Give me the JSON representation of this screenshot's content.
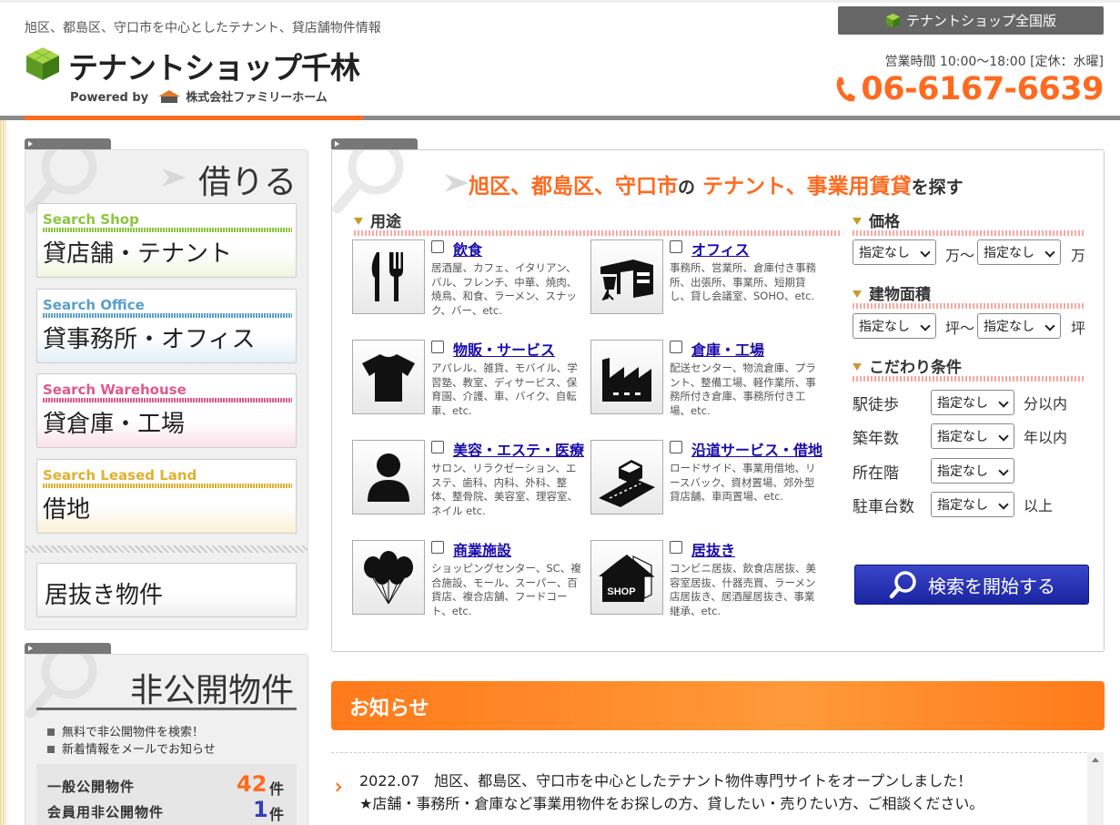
{
  "header": {
    "tagline": "旭区、都島区、守口市を中心としたテナント、貸店舗物件情報",
    "logo_name": "テナントショップ千林",
    "powered_by": "Powered by",
    "company": "株式会社ファミリーホーム",
    "national_button": "テナントショップ全国版",
    "hours": "営業時間 10:00〜18:00 [定休：水曜]",
    "phone": "06-6167-6639"
  },
  "sidebar": {
    "rent_title": "借りる",
    "items": [
      {
        "en": "Search Shop",
        "jp": "貸店舗・テナント",
        "color": "#8cc63f"
      },
      {
        "en": "Search Office",
        "jp": "貸事務所・オフィス",
        "color": "#5aa0c8"
      },
      {
        "en": "Search Warehouse",
        "jp": "貸倉庫・工場",
        "color": "#e0588a"
      },
      {
        "en": "Search Leased Land",
        "jp": "借地",
        "color": "#e0b030"
      }
    ],
    "ibasho": "居抜き物件",
    "private_title": "非公開物件",
    "private_lines": [
      "無料で非公開物件を検索！",
      "新着情報をメールでお知らせ"
    ],
    "counts": [
      {
        "label": "一般公開物件",
        "value": "42",
        "unit": "件",
        "color": "#ff6a1f"
      },
      {
        "label": "会員用非公開物件",
        "value": "1",
        "unit": "件",
        "color": "#3340b8"
      }
    ]
  },
  "search": {
    "heading_areas": "旭区、都島区、守口市",
    "heading_no": "の",
    "heading_type": "テナント、事業用賃貸",
    "heading_suffix": "を探す",
    "usage_title": "用途",
    "usages": [
      {
        "label": "飲食",
        "desc": "居酒屋、カフェ、イタリアン、バル、フレンチ、中華、焼肉、焼鳥、和食、ラーメン、スナック、バー、etc.",
        "icon": "fork-knife-icon"
      },
      {
        "label": "オフィス",
        "desc": "事務所、営業所、倉庫付き事務所、出張所、事業所、短期貸し、貸し会議室、SOHO、etc.",
        "icon": "office-desk-icon"
      },
      {
        "label": "物販・サービス",
        "desc": "アパレル、雑貨、モバイル、学習塾、教室、ディサービス、保育園、介護、車、バイク、自転車、etc.",
        "icon": "tshirt-icon"
      },
      {
        "label": "倉庫・工場",
        "desc": "配送センター、物流倉庫、プラント、整備工場、軽作業所、事務所付き倉庫、事務所付き工場、etc.",
        "icon": "factory-icon"
      },
      {
        "label": "美容・エステ・医療",
        "desc": "サロン、リラクゼーション、エステ、歯科、内科、外科、整体、整骨院、美容室、理容室、ネイル etc.",
        "icon": "person-icon"
      },
      {
        "label": "沿道サービス・借地",
        "desc": "ロードサイド、事業用借地、リースバック、資材置場、郊外型貸店舗、車両置場、etc.",
        "icon": "roadside-icon"
      },
      {
        "label": "商業施設",
        "desc": "ショッピングセンター、SC、複合施設、モール、スーパー、百貨店、複合店舗、フードコート、etc.",
        "icon": "balloons-icon"
      },
      {
        "label": "居抜き",
        "desc": "コンビニ居抜、飲食店居抜、美容室居抜、什器売買、ラーメン店居抜き、居酒屋居抜き、事業継承、etc.",
        "icon": "shop-house-icon"
      }
    ],
    "price_title": "価格",
    "price_from": "指定なし",
    "price_from_unit": "万〜",
    "price_to": "指定なし",
    "price_to_unit": "万",
    "area_title": "建物面積",
    "area_from": "指定なし",
    "area_from_unit": "坪〜",
    "area_to": "指定なし",
    "area_to_unit": "坪",
    "cond_title": "こだわり条件",
    "conditions": [
      {
        "label": "駅徒歩",
        "value": "指定なし",
        "unit": "分以内"
      },
      {
        "label": "築年数",
        "value": "指定なし",
        "unit": "年以内"
      },
      {
        "label": "所在階",
        "value": "指定なし",
        "unit": ""
      },
      {
        "label": "駐車台数",
        "value": "指定なし",
        "unit": "以上"
      }
    ],
    "submit": "検索を開始する"
  },
  "news": {
    "title": "お知らせ",
    "line1": "2022.07　旭区、都島区、守口市を中心としたテナント物件専門サイトをオープンしました！",
    "line2": "★店舗・事務所・倉庫など事業用物件をお探しの方、貸したい・売りたい方、ご相談ください。"
  }
}
